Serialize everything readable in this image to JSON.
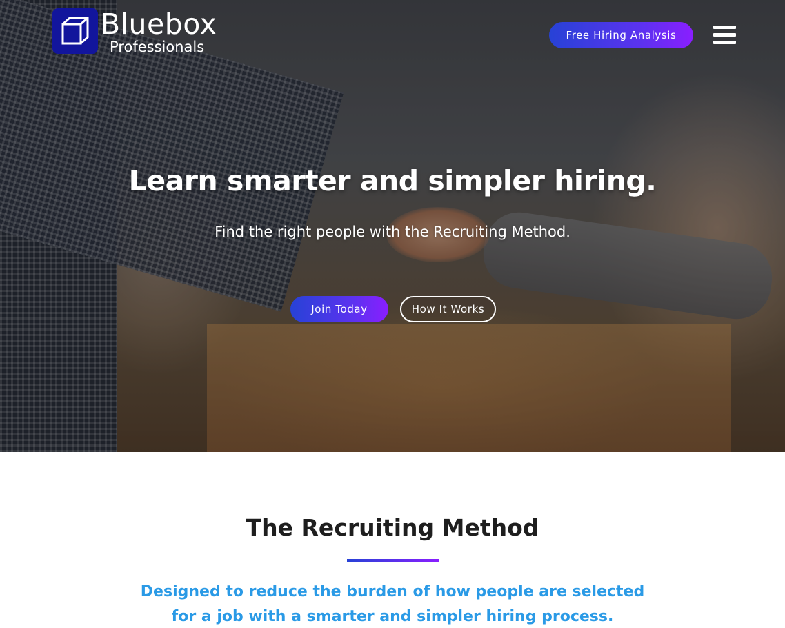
{
  "brand": {
    "name": "Bluebox",
    "subtitle": "Professionals",
    "logo_icon": "cube-icon",
    "color": "#12159c"
  },
  "nav": {
    "cta_label": "Free Hiring Analysis",
    "menu_icon": "hamburger-menu-icon"
  },
  "hero": {
    "title": "Learn smarter and simpler hiring.",
    "subtitle": "Find the right people with the Recruiting Method.",
    "primary_button": "Join Today",
    "secondary_button": "How It Works"
  },
  "section": {
    "title": "The Recruiting Method",
    "description_lines": [
      "Designed to reduce the burden of how people are selected",
      "for a job with a smarter and simpler hiring process."
    ]
  },
  "colors": {
    "accent_gradient_start": "#2742d6",
    "accent_gradient_end": "#8a1eff",
    "highlight_text": "#2a9ae6",
    "heading_text": "#1e1e1e"
  }
}
